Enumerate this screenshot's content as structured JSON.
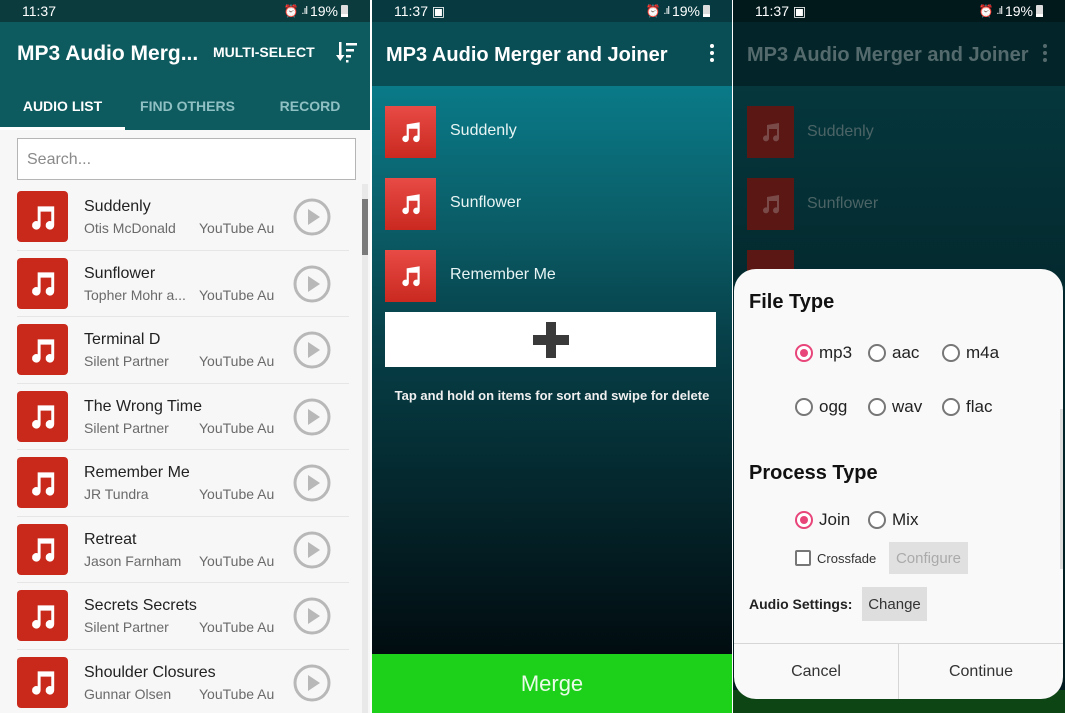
{
  "status_bar": {
    "time": "11:37",
    "battery": "19%"
  },
  "screen1": {
    "title": "MP3 Audio Merg...",
    "multi_select": "MULTI-SELECT",
    "tabs": [
      {
        "label": "AUDIO LIST",
        "active": true
      },
      {
        "label": "FIND OTHERS",
        "active": false
      },
      {
        "label": "RECORD",
        "active": false
      }
    ],
    "search_placeholder": "Search...",
    "songs": [
      {
        "title": "Suddenly",
        "artist": "Otis McDonald",
        "source": "YouTube Au"
      },
      {
        "title": "Sunflower",
        "artist": "Topher Mohr a...",
        "source": "YouTube Au"
      },
      {
        "title": "Terminal D",
        "artist": "Silent Partner",
        "source": "YouTube Au"
      },
      {
        "title": "The Wrong Time",
        "artist": "Silent Partner",
        "source": "YouTube Au"
      },
      {
        "title": "Remember Me",
        "artist": "JR Tundra",
        "source": "YouTube Au"
      },
      {
        "title": "Retreat",
        "artist": "Jason Farnham",
        "source": "YouTube Au"
      },
      {
        "title": "Secrets Secrets",
        "artist": "Silent Partner",
        "source": "YouTube Au"
      },
      {
        "title": "Shoulder Closures",
        "artist": "Gunnar Olsen",
        "source": "YouTube Au"
      }
    ]
  },
  "screen2": {
    "title": "MP3 Audio Merger and Joiner",
    "selected": [
      "Suddenly",
      "Sunflower",
      "Remember Me"
    ],
    "hint": "Tap and hold on items for sort and swipe for delete",
    "merge_label": "Merge",
    "merge_color": "#1dd11a"
  },
  "screen3": {
    "title": "MP3 Audio Merger and Joiner",
    "background_items": [
      "Suddenly",
      "Sunflower"
    ],
    "dialog": {
      "file_type_heading": "File Type",
      "file_types": [
        {
          "label": "mp3",
          "selected": true
        },
        {
          "label": "aac",
          "selected": false
        },
        {
          "label": "m4a",
          "selected": false
        },
        {
          "label": "ogg",
          "selected": false
        },
        {
          "label": "wav",
          "selected": false
        },
        {
          "label": "flac",
          "selected": false
        }
      ],
      "process_type_heading": "Process Type",
      "process_types": [
        {
          "label": "Join",
          "selected": true
        },
        {
          "label": "Mix",
          "selected": false
        }
      ],
      "crossfade_label": "Crossfade",
      "crossfade_checked": false,
      "configure_label": "Configure",
      "audio_settings_label": "Audio Settings:",
      "change_label": "Change",
      "cancel_label": "Cancel",
      "continue_label": "Continue",
      "accent_color": "#e8457a"
    }
  }
}
